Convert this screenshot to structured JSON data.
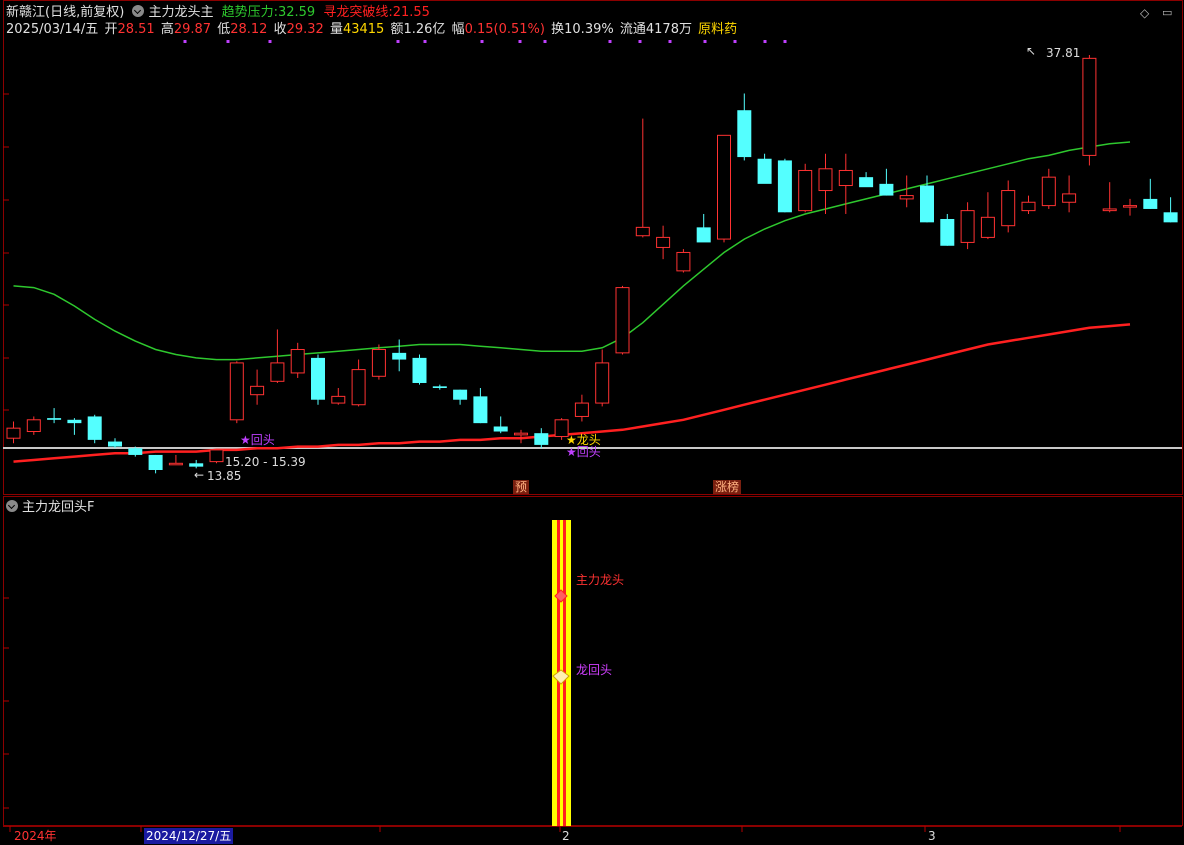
{
  "header": {
    "stock_name": "新赣江",
    "period": "(日线,前复权)",
    "indicator_name": "主力龙头主",
    "trend_label": "趋势压力:",
    "trend_value": "32.59",
    "break_label": "寻龙突破线:",
    "break_value": "21.55"
  },
  "quote": {
    "date": "2025/03/14/五",
    "open_label": "开",
    "open": "28.51",
    "high_label": "高",
    "high": "29.87",
    "low_label": "低",
    "low": "28.12",
    "close_label": "收",
    "close": "29.32",
    "volume_label": "量",
    "volume": "43415",
    "amount_label": "额",
    "amount": "1.26亿",
    "change_label": "幅",
    "change": "0.15(0.51%)",
    "turnover_label": "换",
    "turnover": "10.39%",
    "float_label": "流通",
    "float": "4178万",
    "sector": "原料药"
  },
  "annotations": {
    "max_price": "37.81",
    "min_price": "13.85",
    "range_label": "15.20 - 15.39",
    "huitou_1": "★回头",
    "longtou": "★龙头",
    "huitou_2": "★回头",
    "tag_yu": "预",
    "tag_zhangbang": "涨榜"
  },
  "sub_panel": {
    "title": "主力龙回头F",
    "signal_1": "主力龙头",
    "signal_2": "龙回头"
  },
  "time_axis": {
    "year": "2024年",
    "cursor_date": "2024/12/27/五",
    "month_2": "2",
    "month_3": "3"
  },
  "colors": {
    "up": "#ff3232",
    "down": "#54ffff",
    "ma_fast": "#2ec82e",
    "ma_slow": "#ff2020",
    "grid": "#8b0000"
  },
  "chart_data": {
    "type": "candlestick",
    "series": [
      {
        "name": "candles",
        "ohlc": [
          [
            14.9,
            15.9,
            14.6,
            15.5
          ],
          [
            15.3,
            16.2,
            15.1,
            16.0
          ],
          [
            16.1,
            16.7,
            15.8,
            16.0
          ],
          [
            16.0,
            16.1,
            15.1,
            15.8
          ],
          [
            16.2,
            16.3,
            14.6,
            14.8
          ],
          [
            14.7,
            14.9,
            14.3,
            14.4
          ],
          [
            14.3,
            14.4,
            13.8,
            13.9
          ],
          [
            13.9,
            13.9,
            12.8,
            13.0
          ],
          [
            13.4,
            13.9,
            13.3,
            13.4
          ],
          [
            13.4,
            13.6,
            13.1,
            13.2
          ],
          [
            13.5,
            14.2,
            13.4,
            14.2
          ],
          [
            16.0,
            19.5,
            15.8,
            19.4
          ],
          [
            17.5,
            19.0,
            16.9,
            18.0
          ],
          [
            18.3,
            21.4,
            18.2,
            19.4
          ],
          [
            18.8,
            20.6,
            18.5,
            20.2
          ],
          [
            19.7,
            19.9,
            16.9,
            17.2
          ],
          [
            17.0,
            17.9,
            16.9,
            17.4
          ],
          [
            16.9,
            19.6,
            16.8,
            19.0
          ],
          [
            18.6,
            20.5,
            18.4,
            20.2
          ],
          [
            20.0,
            20.8,
            18.9,
            19.6
          ],
          [
            19.7,
            19.9,
            18.1,
            18.2
          ],
          [
            18.0,
            18.1,
            17.8,
            17.9
          ],
          [
            17.8,
            17.8,
            16.9,
            17.2
          ],
          [
            17.4,
            17.9,
            15.8,
            15.8
          ],
          [
            15.6,
            16.2,
            15.2,
            15.3
          ],
          [
            15.1,
            15.4,
            14.6,
            15.2
          ],
          [
            15.2,
            15.5,
            14.3,
            14.5
          ],
          [
            15.0,
            16.1,
            14.8,
            16.0
          ],
          [
            16.2,
            17.5,
            15.9,
            17.0
          ],
          [
            17.0,
            20.2,
            16.8,
            19.4
          ],
          [
            20.0,
            24.0,
            19.9,
            23.9
          ],
          [
            27.0,
            34.0,
            26.9,
            27.5
          ],
          [
            26.3,
            27.6,
            25.6,
            26.9
          ],
          [
            24.9,
            26.2,
            24.8,
            26.0
          ],
          [
            27.5,
            28.3,
            26.8,
            26.6
          ],
          [
            26.8,
            33.0,
            26.6,
            33.0
          ],
          [
            34.5,
            35.5,
            31.5,
            31.7
          ],
          [
            31.6,
            31.9,
            30.2,
            30.1
          ],
          [
            31.5,
            31.6,
            28.4,
            28.4
          ],
          [
            28.5,
            31.3,
            28.4,
            30.9
          ],
          [
            29.7,
            31.9,
            28.3,
            31.0
          ],
          [
            30.0,
            31.9,
            28.3,
            30.9
          ],
          [
            30.5,
            30.8,
            30.2,
            29.9
          ],
          [
            30.1,
            31.0,
            29.4,
            29.4
          ],
          [
            29.2,
            30.6,
            28.7,
            29.4
          ],
          [
            30.0,
            30.6,
            27.8,
            27.8
          ],
          [
            28.0,
            28.3,
            26.4,
            26.4
          ],
          [
            26.6,
            29.0,
            26.2,
            28.5
          ],
          [
            26.9,
            29.6,
            26.8,
            28.1
          ],
          [
            27.6,
            30.3,
            27.2,
            29.7
          ],
          [
            28.5,
            29.4,
            28.3,
            29.0
          ],
          [
            28.8,
            31.0,
            28.6,
            30.5
          ],
          [
            29.0,
            30.6,
            28.4,
            29.5
          ],
          [
            31.8,
            37.8,
            31.2,
            37.6
          ],
          [
            28.5,
            30.2,
            28.4,
            28.6
          ],
          [
            28.8,
            29.2,
            28.2,
            28.8
          ],
          [
            29.2,
            30.4,
            28.6,
            28.6
          ],
          [
            28.4,
            29.3,
            27.8,
            27.8
          ]
        ]
      },
      {
        "name": "ma_fast",
        "values": [
          24.0,
          23.9,
          23.5,
          22.8,
          22.0,
          21.3,
          20.7,
          20.2,
          19.9,
          19.7,
          19.6,
          19.6,
          19.7,
          19.8,
          19.9,
          20.0,
          20.1,
          20.2,
          20.3,
          20.4,
          20.5,
          20.5,
          20.5,
          20.4,
          20.3,
          20.2,
          20.1,
          20.1,
          20.1,
          20.3,
          20.9,
          21.8,
          22.9,
          24.0,
          25.0,
          26.0,
          26.8,
          27.4,
          27.9,
          28.3,
          28.6,
          28.9,
          29.2,
          29.5,
          29.8,
          30.1,
          30.4,
          30.7,
          31.0,
          31.3,
          31.6,
          31.8,
          32.1,
          32.3,
          32.5,
          32.6
        ]
      },
      {
        "name": "ma_slow",
        "values": [
          13.5,
          13.6,
          13.7,
          13.8,
          13.9,
          14.0,
          14.0,
          14.1,
          14.1,
          14.1,
          14.2,
          14.2,
          14.3,
          14.3,
          14.4,
          14.4,
          14.5,
          14.5,
          14.6,
          14.6,
          14.7,
          14.7,
          14.8,
          14.8,
          14.9,
          14.9,
          15.0,
          15.1,
          15.2,
          15.3,
          15.4,
          15.6,
          15.8,
          16.0,
          16.3,
          16.6,
          16.9,
          17.2,
          17.5,
          17.8,
          18.1,
          18.4,
          18.7,
          19.0,
          19.3,
          19.6,
          19.9,
          20.2,
          20.5,
          20.7,
          20.9,
          21.1,
          21.3,
          21.5,
          21.6,
          21.7
        ]
      }
    ]
  }
}
